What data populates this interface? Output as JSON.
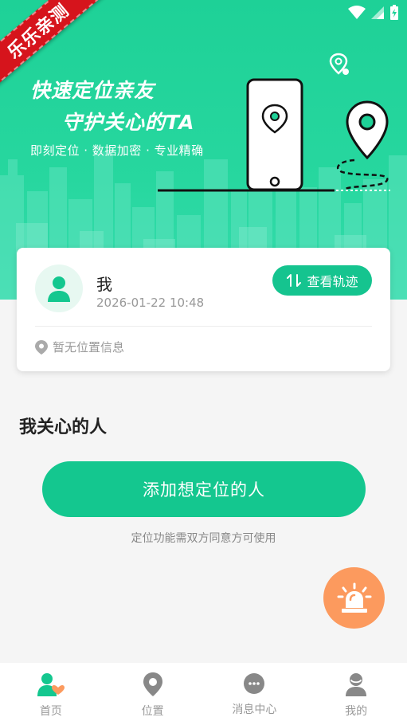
{
  "ribbon": {
    "text": "乐乐亲测"
  },
  "hero": {
    "title_line1": "快速定位亲友",
    "title_line2": "守护关心的TA",
    "subtitle": "即刻定位 · 数据加密 · 专业精确"
  },
  "profile_card": {
    "name": "我",
    "time": "2026-01-22 10:48",
    "track_button": "查看轨迹",
    "location_text": "暂无位置信息"
  },
  "care": {
    "section_title": "我关心的人",
    "add_button": "添加想定位的人",
    "hint": "定位功能需双方同意方可使用"
  },
  "tabs": [
    {
      "label": "首页",
      "icon": "home-person-icon"
    },
    {
      "label": "位置",
      "icon": "location-pin-icon"
    },
    {
      "label": "消息中心",
      "icon": "chat-bubble-icon"
    },
    {
      "label": "我的",
      "icon": "user-icon"
    }
  ],
  "colors": {
    "brand": "#14c78f",
    "hero_bg": "#1ed197",
    "sos": "#fc9a5e",
    "ribbon": "#d6141c"
  }
}
